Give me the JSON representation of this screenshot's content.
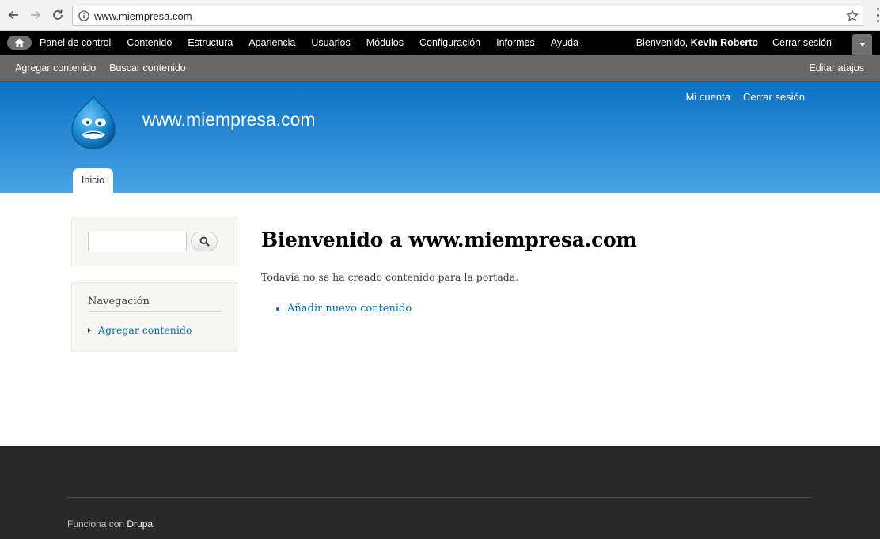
{
  "browser": {
    "url": "www.miempresa.com",
    "icons": [
      "back-icon",
      "forward-icon",
      "reload-icon",
      "info-icon",
      "star-icon",
      "menu-dots-icon"
    ]
  },
  "toolbar": {
    "menu": [
      "Panel de control",
      "Contenido",
      "Estructura",
      "Apariencia",
      "Usuarios",
      "Módulos",
      "Configuración",
      "Informes",
      "Ayuda"
    ],
    "welcome_prefix": "Bienvenido,",
    "user_name": "Kevin Roberto",
    "logout": "Cerrar sesión"
  },
  "shortcuts": {
    "items": [
      "Agregar contenido",
      "Buscar contenido"
    ],
    "edit": "Editar atajos"
  },
  "header": {
    "site_name": "www.miempresa.com",
    "secondary_menu": [
      "Mi cuenta",
      "Cerrar sesión"
    ],
    "main_tab": "Inicio"
  },
  "sidebar": {
    "navigation_title": "Navegación",
    "navigation_items": [
      "Agregar contenido"
    ]
  },
  "content": {
    "title": "Bienvenido a www.miempresa.com",
    "intro": "Todavía no se ha creado contenido para la portada.",
    "add_link": "Añadir nuevo contenido"
  },
  "footer": {
    "powered_prefix": "Funciona con",
    "powered_link": "Drupal"
  },
  "colors": {
    "header_top": "#0b71c2",
    "header_bottom": "#4aa3e2",
    "link": "#0071b3",
    "footer_bg": "#292929"
  }
}
